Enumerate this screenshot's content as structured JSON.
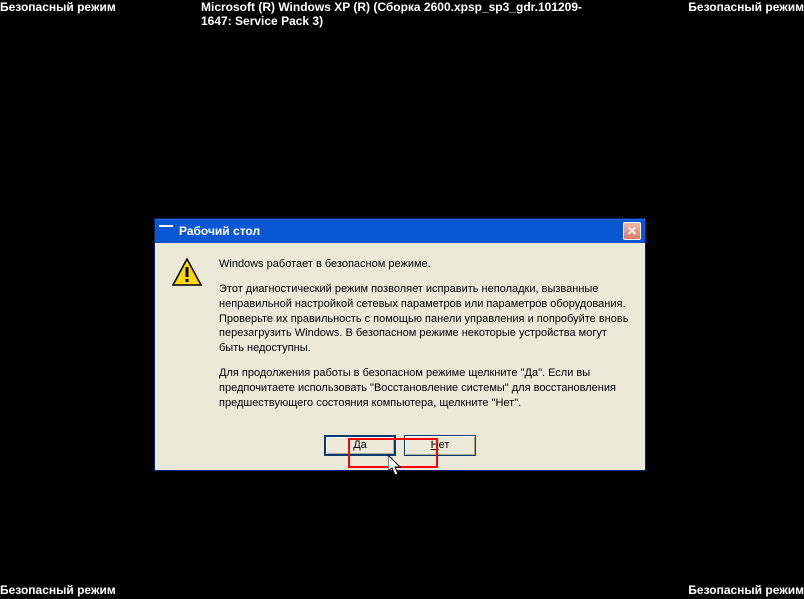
{
  "overlay": {
    "safe_mode_label": "Безопасный режим",
    "system_info": "Microsoft (R) Windows XP (R) (Сборка 2600.xpsp_sp3_gdr.101209-1647: Service Pack 3)"
  },
  "dialog": {
    "title": "Рабочий стол",
    "close_symbol": "✕",
    "paragraph1": "Windows работает в безопасном режиме.",
    "paragraph2": "Этот диагностический режим позволяет исправить неполадки, вызванные неправильной настройкой сетевых параметров или параметров оборудования. Проверьте их правильность с помощью панели управления и попробуйте вновь перезагрузить Windows. В безопасном режиме некоторые устройства могут быть недоступны.",
    "paragraph3": "Для продолжения работы в безопасном режиме щелкните \"Да\". Если вы предпочитаете использовать \"Восстановление системы\" для восстановления предшествующего состояния компьютера, щелкните \"Нет\".",
    "yes_label": "Да",
    "no_label": "Нет"
  }
}
